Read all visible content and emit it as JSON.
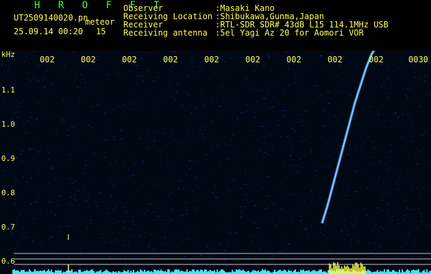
{
  "header": {
    "brand": "H R O F F T",
    "filename": "UT2509140020.pn",
    "type_label": "meteor",
    "datetime": "25.09.14 00:20",
    "count": "15",
    "fields": [
      {
        "label": "Observer",
        "value": ":Masaki Kano"
      },
      {
        "label": "Receiving Location",
        "value": ":Shibukawa,Gunma,Japan"
      },
      {
        "label": "Receiver",
        "value": ":RTL-SDR SDR# 43dB L15 114.1MHz USB"
      },
      {
        "label": "Receiving antenna",
        "value": ":5el Yagi Az 20 for Aomori VOR"
      }
    ]
  },
  "spectrogram": {
    "unit": "kHz",
    "y_ticks": [
      "1.1",
      "1.0",
      "0.9",
      "0.8",
      "0.7",
      "0.6"
    ],
    "x_ticks": [
      "002",
      "002",
      "002",
      "002",
      "002",
      "002",
      "002",
      "002",
      "002",
      "0030"
    ],
    "colors": {
      "background": "#000814",
      "noise": "#1a2a88",
      "trace": "#49a8ff",
      "trace_core": "#c8ecff",
      "baseline": "#48e0ff",
      "burst": "#ffff40",
      "lines": "#c8c8c8"
    }
  }
}
